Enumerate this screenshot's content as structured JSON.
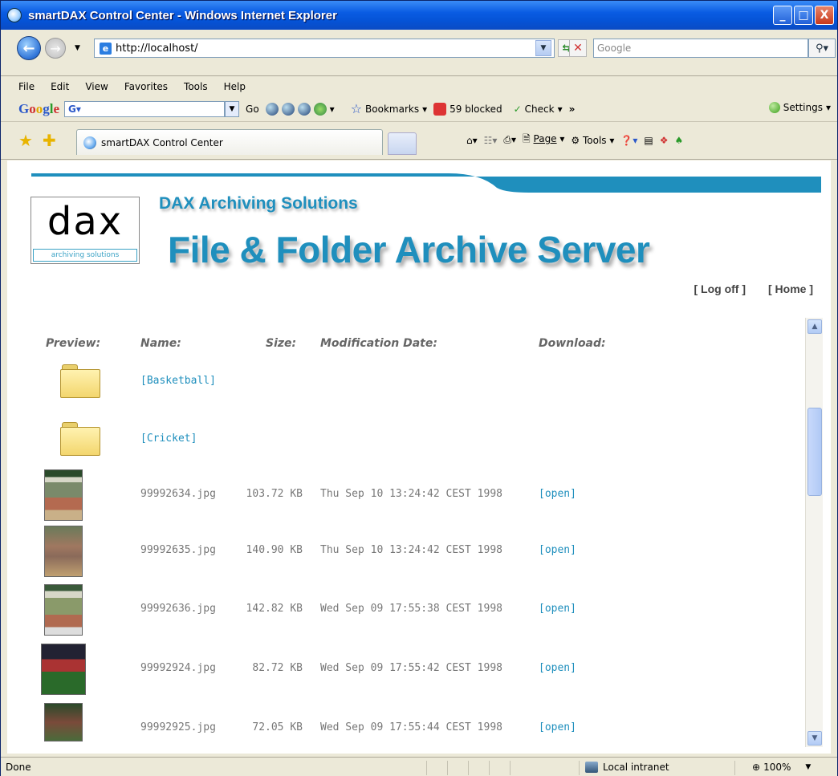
{
  "window": {
    "title": "smartDAX Control Center - Windows Internet Explorer",
    "min_label": "_",
    "max_label": "□",
    "close_label": "X"
  },
  "address": {
    "url": "http://localhost/",
    "search_placeholder": "Google"
  },
  "menu": [
    "File",
    "Edit",
    "View",
    "Favorites",
    "Tools",
    "Help"
  ],
  "google_toolbar": {
    "go_label": "Go",
    "bookmarks_label": "Bookmarks",
    "blocked_label": "59 blocked",
    "check_label": "Check",
    "more_label": "»",
    "settings_label": "Settings"
  },
  "tab": {
    "title": "smartDAX Control Center"
  },
  "commandbar": {
    "page_label": "Page",
    "tools_label": "Tools"
  },
  "page": {
    "logo_text": "dax",
    "logo_sub": "archiving solutions",
    "tagline": "DAX Archiving Solutions",
    "heading": "File & Folder Archive Server",
    "logoff_link": "[ Log off ]",
    "home_link": "[ Home ]"
  },
  "table": {
    "headers": {
      "preview": "Preview:",
      "name": "Name:",
      "size": "Size:",
      "date": "Modification Date:",
      "download": "Download:"
    },
    "folders": [
      {
        "name": "[Basketball]"
      },
      {
        "name": "[Cricket]"
      }
    ],
    "files": [
      {
        "name": "99992634.jpg",
        "size": "103.72 KB",
        "date": "Thu Sep 10 13:24:42 CEST 1998",
        "link": "[open]"
      },
      {
        "name": "99992635.jpg",
        "size": "140.90 KB",
        "date": "Thu Sep 10 13:24:42 CEST 1998",
        "link": "[open]"
      },
      {
        "name": "99992636.jpg",
        "size": "142.82 KB",
        "date": "Wed Sep 09 17:55:38 CEST 1998",
        "link": "[open]"
      },
      {
        "name": "99992924.jpg",
        "size": "82.72 KB",
        "date": "Wed Sep 09 17:55:42 CEST 1998",
        "link": "[open]"
      },
      {
        "name": "99992925.jpg",
        "size": "72.05 KB",
        "date": "Wed Sep 09 17:55:44 CEST 1998",
        "link": "[open]"
      }
    ]
  },
  "status": {
    "text": "Done",
    "zone": "Local intranet",
    "zoom": "100%"
  },
  "colors": {
    "accent": "#1f8fbd",
    "titlebar": "#0a5ce3"
  }
}
